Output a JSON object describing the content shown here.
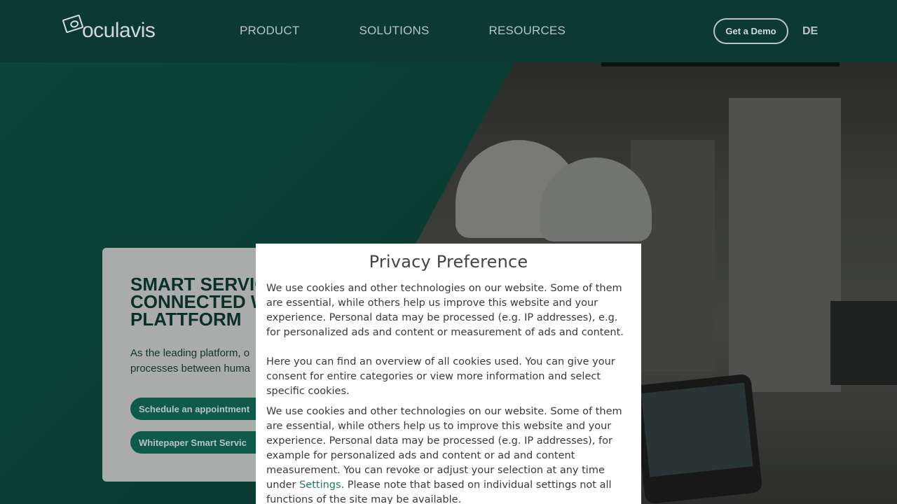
{
  "header": {
    "logo_text": "oculavis",
    "nav": [
      "PRODUCT",
      "SOLUTIONS",
      "RESOURCES"
    ],
    "demo_button": "Get a Demo",
    "language": "DE"
  },
  "hero": {
    "title": "SMART SERVIC\nCONNECTED W\nPLATTFORM",
    "text": "As the leading platform, o\nprocesses between huma",
    "buttons": [
      "Schedule an appointment",
      "Whitepaper Smart Servic"
    ]
  },
  "modal": {
    "title": "Privacy Preference",
    "paragraph1": "We use cookies and other technologies on our website. Some of them are essential, while others help us improve this website and your experience. Personal data may be processed (e.g. IP addresses), e.g. for personalized ads and content or measurement of ads and content.",
    "paragraph2": "Here you can find an overview of all cookies used. You can give your consent for entire categories or view more information and select specific cookies.",
    "paragraph3_before": "We use cookies and other technologies on our website. Some of them are essential, while others help us to improve this website and your experience. Personal data may be processed (e.g. IP addresses), for example for personalized ads and content or ad and content measurement. You can revoke or adjust your selection at any time under ",
    "settings_link": "Settings",
    "paragraph3_after": ". Please note that based on individual settings not all functions of the site may be available."
  },
  "colors": {
    "header_bg": "#0c3a33",
    "hero_green": "#0f5647",
    "button_green": "#0f5a49",
    "link_green": "#1f7a64"
  }
}
